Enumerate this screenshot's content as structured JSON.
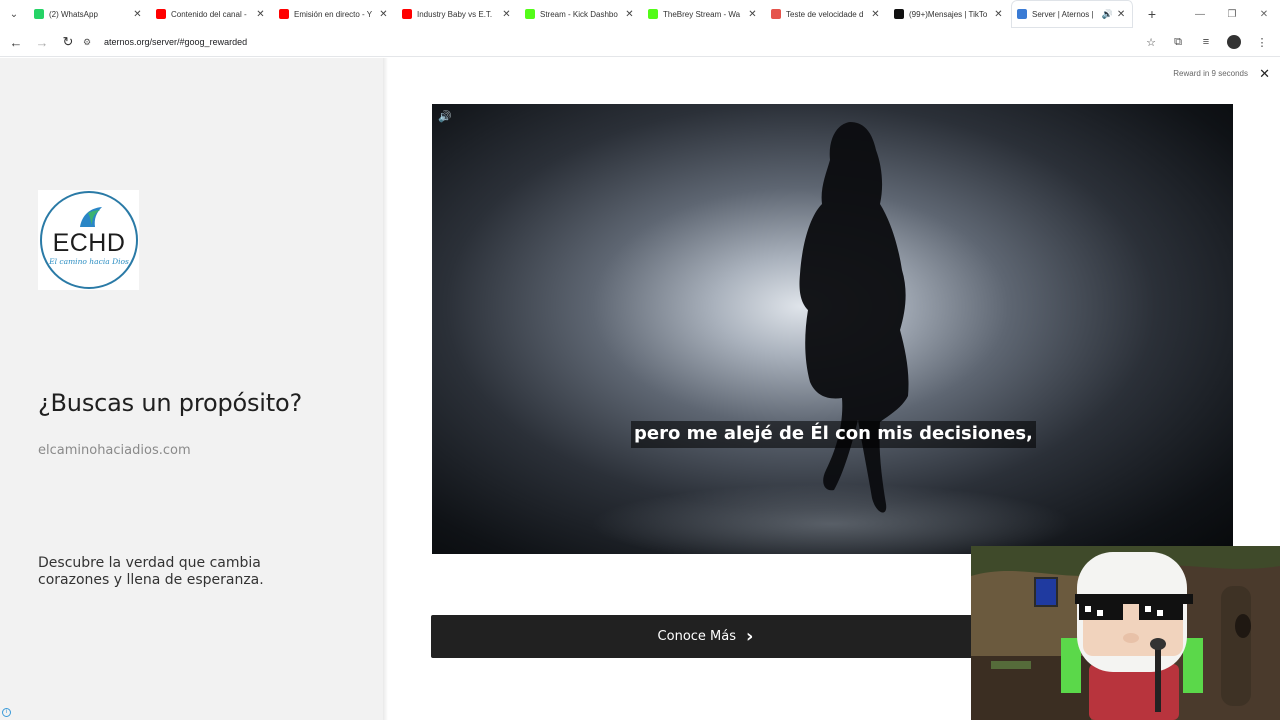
{
  "browser": {
    "tabs": [
      {
        "label": "(2) WhatsApp",
        "favicon_color": "#25d366"
      },
      {
        "label": "Contenido del canal -",
        "favicon_color": "#ff0000"
      },
      {
        "label": "Emisión en directo - Y",
        "favicon_color": "#ff0000"
      },
      {
        "label": "Industry Baby vs E.T.",
        "favicon_color": "#ff0000"
      },
      {
        "label": "Stream - Kick Dashbo",
        "favicon_color": "#53fc18"
      },
      {
        "label": "TheBrey Stream - Wa",
        "favicon_color": "#53fc18"
      },
      {
        "label": "Teste de velocidade d",
        "favicon_color": "#e5534b"
      },
      {
        "label": "(99+)Mensajes | TikTo",
        "favicon_color": "#111111"
      },
      {
        "label": "Server | Aternos |",
        "favicon_color": "#3a7bd5",
        "active": true
      }
    ],
    "url": "aternos.org/server/#goog_rewarded"
  },
  "ad": {
    "logo_text": "ECHD",
    "logo_subtext": "El camino hacia Dios",
    "headline": "¿Buscas un propósito?",
    "domain": "elcaminohaciadios.com",
    "description": "Descubre la verdad que cambia corazones y llena de esperanza.",
    "reward_text": "Reward in 9 seconds",
    "subtitle": "pero me alejé de Él con mis decisiones,",
    "cta_label": "Conoce Más"
  },
  "icons": {
    "volume": "🔊",
    "close": "✕",
    "back": "←",
    "forward": "→",
    "reload": "↻",
    "star": "☆",
    "new_tab": "+",
    "chevron": "›",
    "tab_close": "✕",
    "tab_sound": "🔊"
  },
  "colors": {
    "cta_bg": "#212121",
    "left_panel_bg": "#f2f2f2",
    "logo_ring": "#2a7aa6"
  }
}
